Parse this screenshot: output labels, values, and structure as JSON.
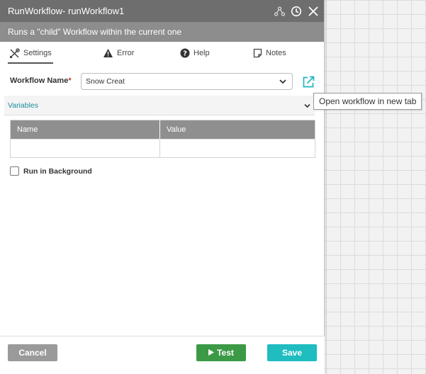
{
  "window": {
    "title": "RunWorkflow-  runWorkflow1",
    "subtitle": "Runs a \"child\" Workflow within the current one",
    "icons": [
      "hierarchy-icon",
      "history-clock-icon",
      "close-icon"
    ]
  },
  "tabs": [
    {
      "label": "Settings",
      "icon": "tools-icon",
      "active": true
    },
    {
      "label": "Error",
      "icon": "warning-icon",
      "active": false
    },
    {
      "label": "Help",
      "icon": "help-icon",
      "active": false
    },
    {
      "label": "Notes",
      "icon": "note-icon",
      "active": false
    }
  ],
  "form": {
    "workflow_name_label": "Workflow Name",
    "required_mark": "*",
    "workflow_name_value": "Snow Creat",
    "open_workflow_tooltip": "Open workflow in new tab"
  },
  "variables": {
    "header": "Variables",
    "columns": [
      "Name",
      "Value"
    ]
  },
  "options": {
    "run_in_background_label": "Run in Background",
    "run_in_background_checked": false
  },
  "footer": {
    "cancel_label": "Cancel",
    "test_label": "Test",
    "save_label": "Save"
  },
  "colors": {
    "titlebar": "#6e6e6e",
    "subtitle_bar": "#8d8d8d",
    "accent_teal": "#1a8f9b",
    "test_green": "#3c9a46",
    "save_teal": "#1fbcc0",
    "cancel_gray": "#9a9a9a",
    "required_red": "#c0392b"
  }
}
